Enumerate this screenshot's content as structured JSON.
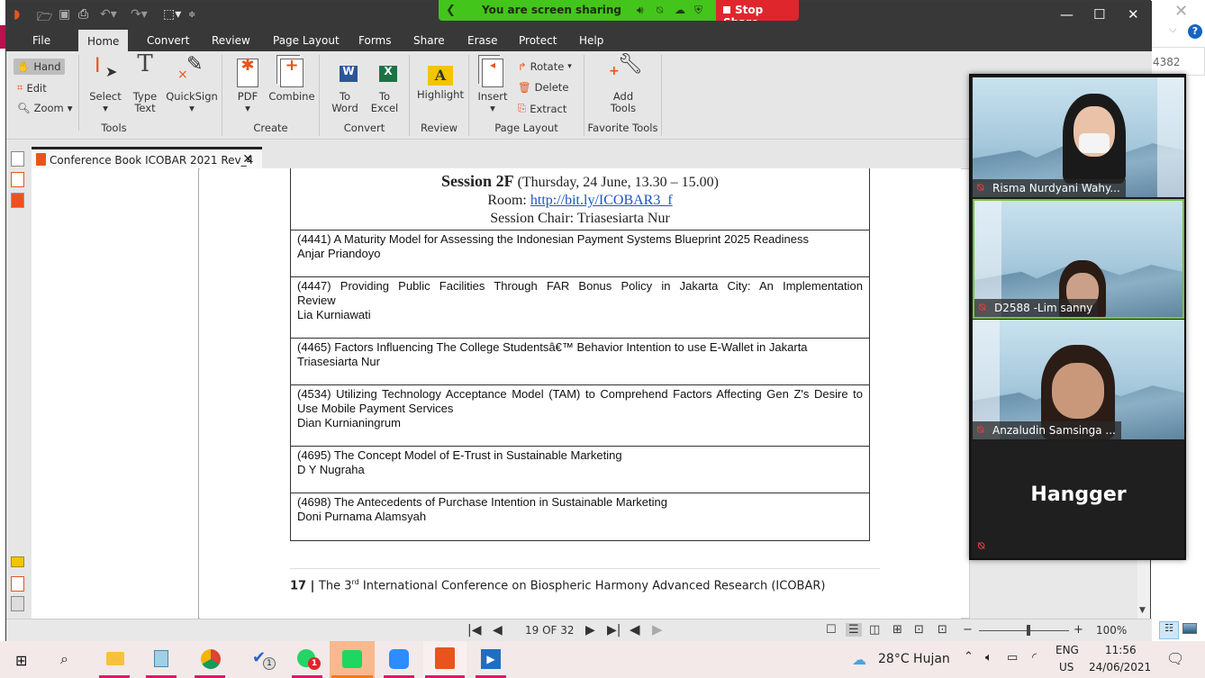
{
  "background_window": {
    "close_glyph": "✕",
    "chevron": "⌵",
    "help": "?",
    "value": "4382"
  },
  "app": {
    "quick_access": {
      "icons": [
        "foxit-logo-icon",
        "open-folder-icon",
        "save-icon",
        "print-icon",
        "undo-icon",
        "redo-icon",
        "select-tool-icon",
        "customize-icon"
      ]
    },
    "menu_tabs": [
      "File",
      "Home",
      "Convert",
      "Review",
      "Page Layout",
      "Forms",
      "Share",
      "Erase",
      "Protect",
      "Help"
    ],
    "active_tab": "Home",
    "window_controls": {
      "minimize": "—",
      "maximize": "☐",
      "close": "✕"
    }
  },
  "screen_share": {
    "status": "You are screen sharing",
    "stop_label": "Stop Share",
    "colors": {
      "bar": "#43c51b",
      "stop": "#e0262d"
    }
  },
  "ribbon": {
    "groups": [
      {
        "label": "Tools",
        "small_items": [
          "Hand",
          "Edit",
          "Zoom"
        ],
        "buttons": [
          "Select",
          "Type Text",
          "QuickSign"
        ]
      },
      {
        "label": "Create",
        "buttons": [
          "PDF",
          "Combine"
        ]
      },
      {
        "label": "Convert",
        "buttons": [
          "To Word",
          "To Excel"
        ]
      },
      {
        "label": "Review",
        "buttons": [
          "Highlight"
        ]
      },
      {
        "label": "Page Layout",
        "buttons": [
          "Insert"
        ],
        "small_items": [
          "Rotate",
          "Delete",
          "Extract"
        ]
      },
      {
        "label": "Favorite Tools",
        "buttons": [
          "Add Tools"
        ]
      }
    ]
  },
  "document": {
    "tab_title": "Conference Book ICOBAR 2021 Rev_4",
    "session": {
      "title": "Session 2F",
      "time": "(Thursday, 24 June, 13.30 – 15.00)",
      "room_label": "Room: ",
      "room_link": "http://bit.ly/ICOBAR3_f",
      "chair": "Session Chair: Triasesiarta Nur"
    },
    "papers": [
      {
        "title": "(4441) A Maturity Model for Assessing the Indonesian Payment Systems Blueprint 2025 Readiness",
        "author": "Anjar Priandoyo"
      },
      {
        "title": "(4447) Providing Public Facilities Through FAR Bonus Policy in Jakarta City: An Implementation Review",
        "author": "Lia Kurniawati"
      },
      {
        "title": "(4465) Factors Influencing  The College Studentsâ€™ Behavior Intention to use E-Wallet in Jakarta",
        "author": "Triasesiarta Nur"
      },
      {
        "title": "(4534) Utilizing Technology Acceptance Model (TAM) to Comprehend Factors Affecting Gen Z's Desire to Use Mobile Payment Services",
        "author": "Dian Kurnianingrum"
      },
      {
        "title": "(4695) The Concept Model of E-Trust in Sustainable Marketing",
        "author": "D Y Nugraha"
      },
      {
        "title": "(4698) The Antecedents of Purchase Intention in Sustainable Marketing",
        "author": "Doni Purnama Alamsyah"
      }
    ],
    "footer": {
      "page_num": "17",
      "sep": " | ",
      "text_pre": "The 3",
      "sup": "rd",
      "text_post": " International Conference on Biospheric Harmony Advanced Research (ICOBAR)"
    }
  },
  "statusbar": {
    "page_indicator": "19 OF 32",
    "zoom": "100%",
    "zoom_level_fraction": 0.55
  },
  "participants": [
    {
      "name": "Risma Nurdyani Wahy...",
      "muted": true
    },
    {
      "name": "D2588 -Lim sanny",
      "muted": true,
      "active_speaker": true
    },
    {
      "name": "Anzaludin Samsinga ...",
      "muted": true
    },
    {
      "name": "Hangger",
      "muted": true,
      "video": false
    }
  ],
  "taskbar": {
    "apps": [
      "start",
      "search",
      "file-explorer",
      "notepad",
      "chrome",
      "todo",
      "whatsapp",
      "spotify",
      "zoom",
      "foxit",
      "media-player"
    ],
    "todo_badge": "1",
    "whatsapp_badge": "1",
    "weather": "28°C  Hujan",
    "lang_top": "ENG",
    "lang_bottom": "US",
    "time": "11:56",
    "date": "24/06/2021"
  }
}
